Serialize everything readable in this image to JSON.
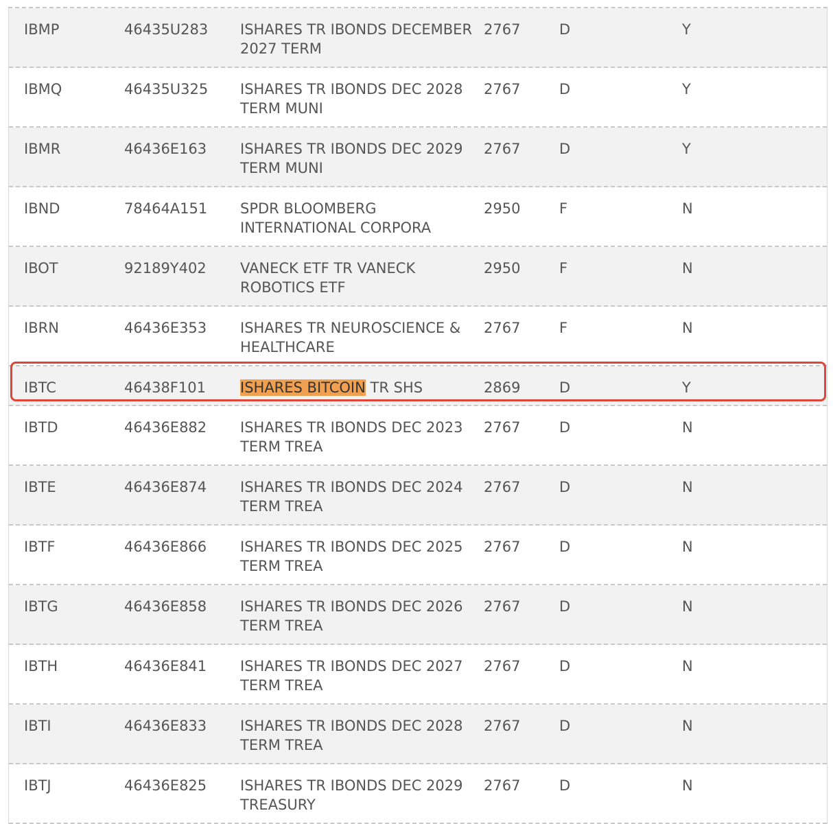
{
  "rows": [
    {
      "symbol": "IBMP",
      "cusip": "46435U283",
      "name": "ISHARES TR IBONDS DECEMBER 2027 TERM",
      "code": "2767",
      "type": "D",
      "flag": "Y"
    },
    {
      "symbol": "IBMQ",
      "cusip": "46435U325",
      "name": "ISHARES TR IBONDS DEC 2028 TERM MUNI",
      "code": "2767",
      "type": "D",
      "flag": "Y"
    },
    {
      "symbol": "IBMR",
      "cusip": "46436E163",
      "name": "ISHARES TR IBONDS DEC 2029 TERM MUNI",
      "code": "2767",
      "type": "D",
      "flag": "Y"
    },
    {
      "symbol": "IBND",
      "cusip": "78464A151",
      "name": "SPDR BLOOMBERG INTERNATIONAL CORPORA",
      "code": "2950",
      "type": "F",
      "flag": "N"
    },
    {
      "symbol": "IBOT",
      "cusip": "92189Y402",
      "name": "VANECK ETF TR VANECK ROBOTICS ETF",
      "code": "2950",
      "type": "F",
      "flag": "N"
    },
    {
      "symbol": "IBRN",
      "cusip": "46436E353",
      "name": "ISHARES TR NEUROSCIENCE & HEALTHCARE",
      "code": "2767",
      "type": "F",
      "flag": "N"
    },
    {
      "symbol": "IBTC",
      "cusip": "46438F101",
      "name_highlight": "ISHARES BITCOIN",
      "name_rest": " TR SHS",
      "code": "2869",
      "type": "D",
      "flag": "Y"
    },
    {
      "symbol": "IBTD",
      "cusip": "46436E882",
      "name": "ISHARES TR IBONDS DEC 2023 TERM TREA",
      "code": "2767",
      "type": "D",
      "flag": "N"
    },
    {
      "symbol": "IBTE",
      "cusip": "46436E874",
      "name": "ISHARES TR IBONDS DEC 2024 TERM TREA",
      "code": "2767",
      "type": "D",
      "flag": "N"
    },
    {
      "symbol": "IBTF",
      "cusip": "46436E866",
      "name": "ISHARES TR IBONDS DEC 2025 TERM TREA",
      "code": "2767",
      "type": "D",
      "flag": "N"
    },
    {
      "symbol": "IBTG",
      "cusip": "46436E858",
      "name": "ISHARES TR IBONDS DEC 2026 TERM TREA",
      "code": "2767",
      "type": "D",
      "flag": "N"
    },
    {
      "symbol": "IBTH",
      "cusip": "46436E841",
      "name": "ISHARES TR IBONDS DEC 2027 TERM TREA",
      "code": "2767",
      "type": "D",
      "flag": "N"
    },
    {
      "symbol": "IBTI",
      "cusip": "46436E833",
      "name": "ISHARES TR IBONDS DEC 2028 TERM TREA",
      "code": "2767",
      "type": "D",
      "flag": "N"
    },
    {
      "symbol": "IBTJ",
      "cusip": "46436E825",
      "name": "ISHARES TR IBONDS DEC 2029 TREASURY",
      "code": "2767",
      "type": "D",
      "flag": "N"
    }
  ],
  "colors": {
    "highlight_fill": "#f0a050",
    "highlight_border": "#e0453a",
    "row_shade": "#f2f2f2"
  }
}
